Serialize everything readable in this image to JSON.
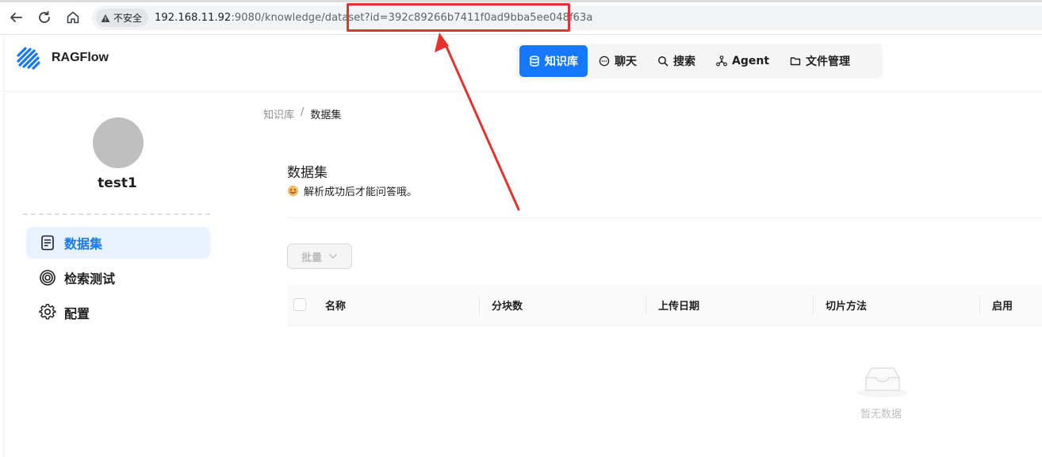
{
  "browser": {
    "security_label": "不安全",
    "url_host": "192.168.11.92",
    "url_rest": ":9080/knowledge/dataset?id=392c89266b7411f0ad9bba5ee048f63a",
    "annotation_color": "#e5322d"
  },
  "header": {
    "brand": "RAGFlow",
    "nav": [
      {
        "label": "知识库",
        "icon": "database-icon",
        "active": true
      },
      {
        "label": "聊天",
        "icon": "chat-icon",
        "active": false
      },
      {
        "label": "搜索",
        "icon": "search-icon",
        "active": false
      },
      {
        "label": "Agent",
        "icon": "agent-icon",
        "active": false
      },
      {
        "label": "文件管理",
        "icon": "folder-icon",
        "active": false
      }
    ],
    "accent_color": "#1677ff"
  },
  "sidebar": {
    "username": "test1",
    "items": [
      {
        "label": "数据集",
        "icon": "document-icon",
        "active": true
      },
      {
        "label": "检索测试",
        "icon": "target-icon",
        "active": false
      },
      {
        "label": "配置",
        "icon": "gear-icon",
        "active": false
      }
    ]
  },
  "breadcrumb": {
    "parent": "知识库",
    "separator": "/",
    "current": "数据集"
  },
  "main": {
    "title": "数据集",
    "subtitle": "解析成功后才能问答哦。",
    "batch_label": "批量",
    "table": {
      "columns": [
        "名称",
        "分块数",
        "上传日期",
        "切片方法",
        "启用"
      ]
    },
    "empty_text": "暂无数据"
  }
}
